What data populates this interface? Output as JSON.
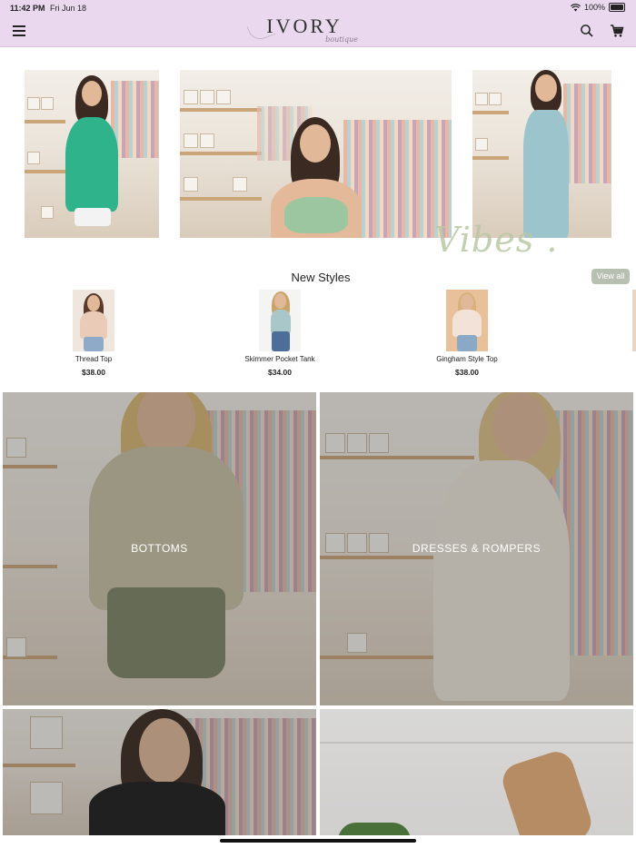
{
  "status_bar": {
    "time": "11:42 PM",
    "date": "Fri Jun 18",
    "battery": "100%"
  },
  "header": {
    "logo_text": "IVORY",
    "logo_sub": "boutique"
  },
  "hero": {
    "overlay_text": "Vibes ."
  },
  "new_styles": {
    "title": "New Styles",
    "view_all_label": "View all",
    "products": [
      {
        "name": "Thread Top",
        "price": "$38.00"
      },
      {
        "name": "Skimmer Pocket Tank",
        "price": "$34.00"
      },
      {
        "name": "Gingham Style Top",
        "price": "$38.00"
      }
    ]
  },
  "categories": [
    {
      "label": "BOTTOMS"
    },
    {
      "label": "DRESSES & ROMPERS"
    }
  ],
  "colors": {
    "header_bg": "#ead9ee",
    "view_all_bg": "#b7bfb0",
    "vibes_text": "#b9c7a4"
  }
}
